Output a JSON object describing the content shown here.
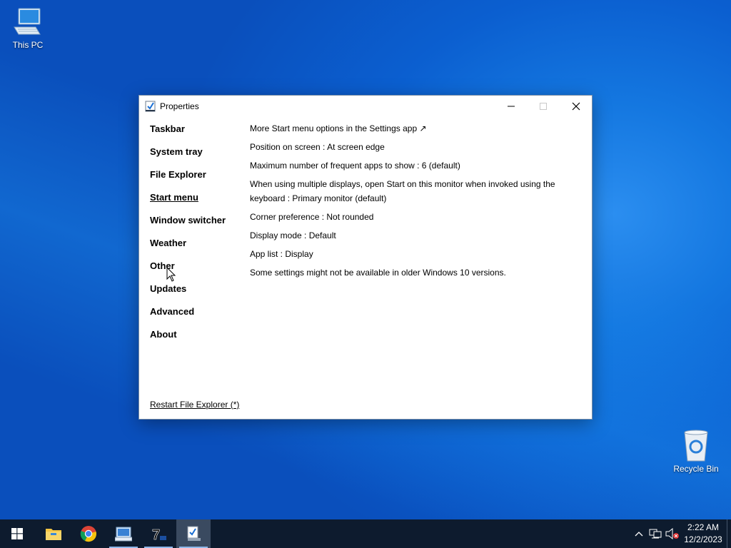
{
  "desktop": {
    "icons": [
      {
        "label": "This PC"
      },
      {
        "label": "Recycle Bin"
      }
    ]
  },
  "window": {
    "title": "Properties",
    "nav": [
      {
        "label": "Taskbar"
      },
      {
        "label": "System tray"
      },
      {
        "label": "File Explorer"
      },
      {
        "label": "Start menu",
        "active": true
      },
      {
        "label": "Window switcher"
      },
      {
        "label": "Weather"
      },
      {
        "label": "Other"
      },
      {
        "label": "Updates"
      },
      {
        "label": "Advanced"
      },
      {
        "label": "About"
      }
    ],
    "settings": [
      "More Start menu options in the Settings app ↗",
      "Position on screen : At screen edge",
      "Maximum number of frequent apps to show : 6 (default)",
      "When using multiple displays, open Start on this monitor when invoked using the keyboard : Primary monitor (default)",
      "Corner preference : Not rounded",
      "Display mode : Default",
      "App list : Display",
      "Some settings might not be available in older Windows 10 versions."
    ],
    "restart_link": "Restart File Explorer (*)"
  },
  "taskbar": {
    "items": [
      {
        "icon": "windows-start-icon"
      },
      {
        "icon": "file-explorer-icon"
      },
      {
        "icon": "chrome-icon"
      },
      {
        "icon": "control-panel-icon"
      },
      {
        "icon": "7zip-icon"
      },
      {
        "icon": "properties-app-icon"
      }
    ],
    "clock": {
      "time": "2:22 AM",
      "date": "12/2/2023"
    }
  },
  "colors": {
    "desktop": "#0b5fd0",
    "taskbar": "#0d1b2e",
    "active_taskbar_item": "#3a4a60"
  }
}
